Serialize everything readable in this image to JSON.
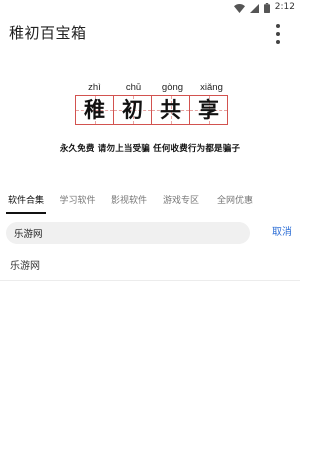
{
  "status_bar": {
    "time": "2:12",
    "icons": [
      "wifi-icon",
      "signal-icon",
      "battery-icon"
    ]
  },
  "app_bar": {
    "title": "稚初百宝箱",
    "menu_icon": "more-vert-icon"
  },
  "banner": {
    "logo": {
      "pinyin": [
        "zhì",
        "chū",
        "gòng",
        "xiǎng"
      ],
      "hanzi": [
        "稚",
        "初",
        "共",
        "享"
      ]
    },
    "slogan": "永久免费 请勿上当受骗 任何收费行为都是骗子"
  },
  "tabs": [
    {
      "label": "软件合集",
      "active": true
    },
    {
      "label": "学习软件",
      "active": false
    },
    {
      "label": "影视软件",
      "active": false
    },
    {
      "label": "游戏专区",
      "active": false
    },
    {
      "label": "全网优惠",
      "active": false
    }
  ],
  "search": {
    "value": "乐游网",
    "cancel_label": "取消"
  },
  "results": [
    {
      "label": "乐游网"
    }
  ],
  "colors": {
    "accent": "#2f6fd6",
    "grid_red": "#d2524f"
  }
}
